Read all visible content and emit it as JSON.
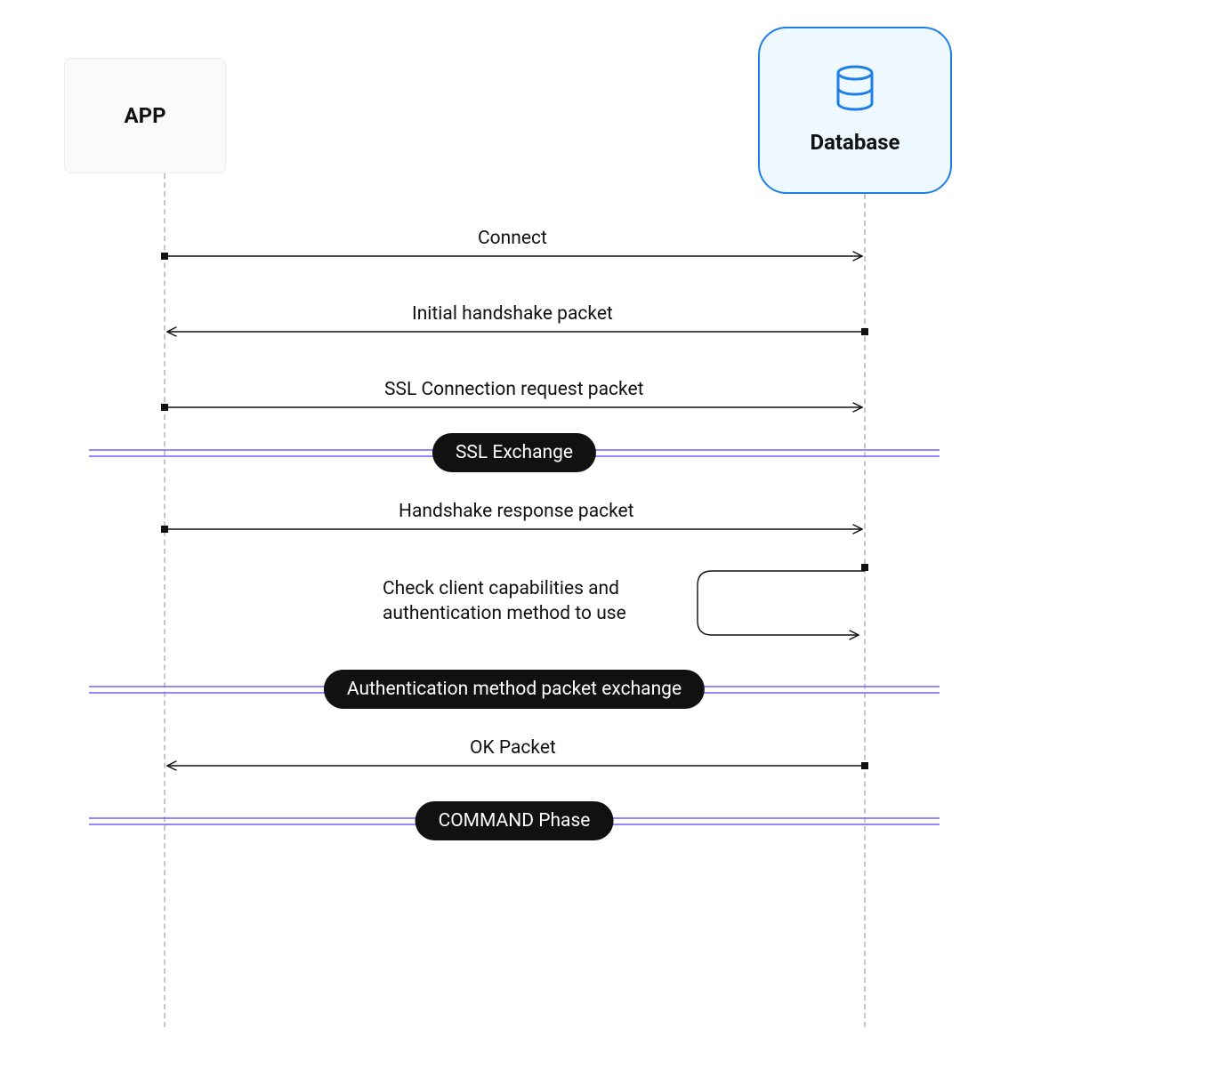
{
  "actors": {
    "app": {
      "label": "APP"
    },
    "db": {
      "label": "Database"
    }
  },
  "messages": {
    "connect": "Connect",
    "initial_handshake": "Initial handshake packet",
    "ssl_request": "SSL Connection request packet",
    "handshake_response": "Handshake response packet",
    "check_caps_l1": "Check client capabilities and",
    "check_caps_l2": "authentication method to use",
    "ok_packet": "OK Packet"
  },
  "phases": {
    "ssl_exchange": "SSL Exchange",
    "auth_exchange": "Authentication method packet exchange",
    "command_phase": "COMMAND Phase"
  },
  "colors": {
    "purple": "#7a5cff",
    "blue": "#1f7fe6",
    "pill_bg": "#111111"
  }
}
